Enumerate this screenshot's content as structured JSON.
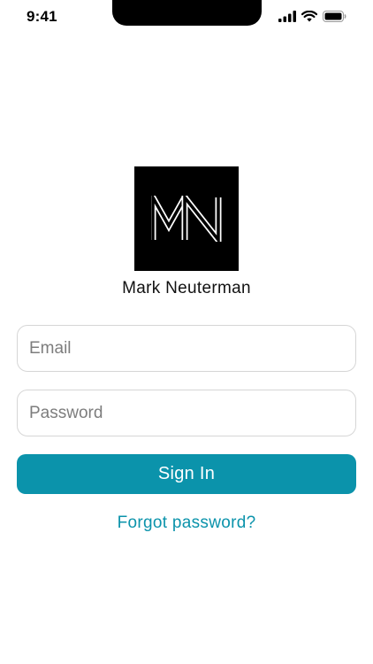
{
  "status_bar": {
    "time": "9:41",
    "icons": [
      "cellular-signal-icon",
      "wifi-icon",
      "battery-icon"
    ]
  },
  "brand": {
    "logo_text": "MN",
    "name": "Mark Neuterman"
  },
  "form": {
    "email_placeholder": "Email",
    "email_value": "",
    "password_placeholder": "Password",
    "password_value": "",
    "sign_in_label": "Sign In",
    "forgot_password_label": "Forgot password?"
  },
  "colors": {
    "accent": "#0b93ab",
    "logo_background": "#000000",
    "background": "#ffffff"
  }
}
